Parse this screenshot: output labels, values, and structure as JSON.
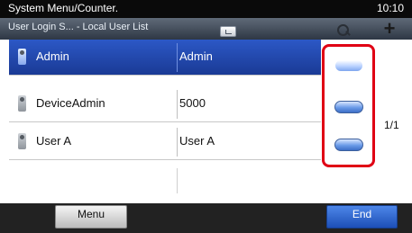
{
  "header": {
    "title": "System Menu/Counter.",
    "clock": "10:10",
    "breadcrumb": "User Login S... - Local User List"
  },
  "icons": {
    "sort": "sort-icon",
    "search": "search-icon",
    "add": "+"
  },
  "users": [
    {
      "name": "Admin",
      "login": "Admin",
      "selected": true
    },
    {
      "name": "DeviceAdmin",
      "login": "5000",
      "selected": false
    },
    {
      "name": "User A",
      "login": "User A",
      "selected": false
    }
  ],
  "pagination": {
    "indicator": "1/1"
  },
  "footer": {
    "menu_label": "Menu",
    "end_label": "End"
  },
  "colors": {
    "highlight": "#e00014",
    "selected_row": "#2c58c6"
  }
}
